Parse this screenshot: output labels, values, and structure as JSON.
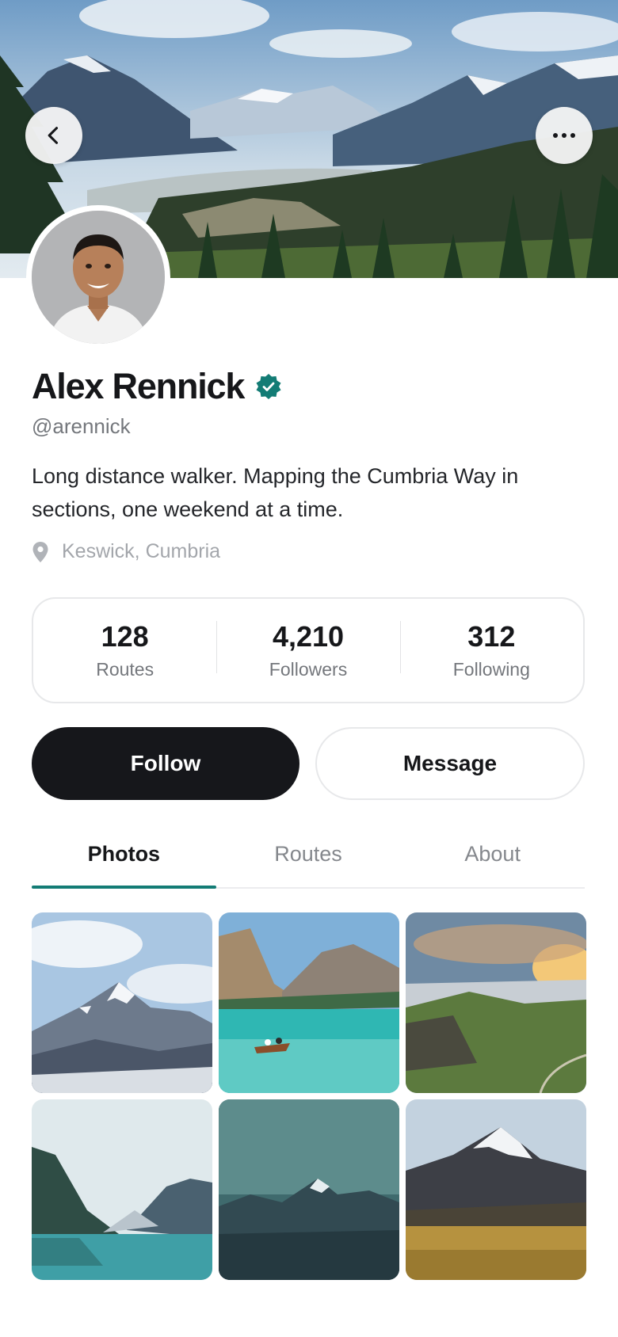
{
  "header": {
    "back_icon": "chevron-left-icon",
    "more_icon": "more-horizontal-icon"
  },
  "profile": {
    "name": "Alex Rennick",
    "verified": true,
    "handle": "@arennick",
    "bio": "Long distance walker. Mapping the Cumbria Way in sections, one weekend at a time.",
    "location": "Keswick, Cumbria"
  },
  "stats": [
    {
      "value": "128",
      "label": "Routes"
    },
    {
      "value": "4,210",
      "label": "Followers"
    },
    {
      "value": "312",
      "label": "Following"
    }
  ],
  "actions": {
    "follow_label": "Follow",
    "message_label": "Message"
  },
  "tabs": [
    {
      "label": "Photos",
      "active": true
    },
    {
      "label": "Routes",
      "active": false
    },
    {
      "label": "About",
      "active": false
    }
  ],
  "colors": {
    "accent": "#137c75",
    "primary_button": "#16171b",
    "verified_badge": "#137c75"
  }
}
